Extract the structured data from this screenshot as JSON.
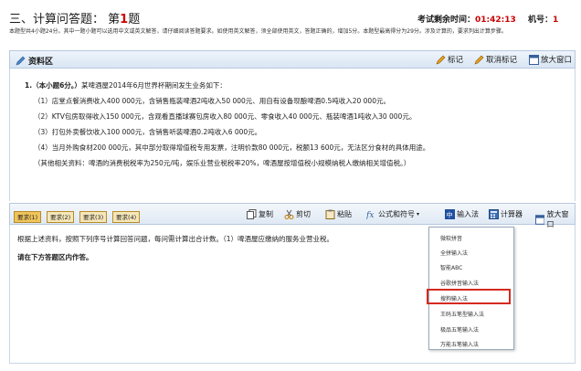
{
  "header": {
    "section": "三、计算问答题：",
    "question_prefix": "第",
    "question_number": "1",
    "question_suffix": "题",
    "timer_label": "考试剩余时间：",
    "timer_value": "01:42:13",
    "machine_label": "机号：",
    "machine_value": "1",
    "note": "本题型共4小题24分。其中一题小题可以选用中文或英文解答，请仔细阅读答题要求。如使用英文解答，须全部使用英文，答题正确的，增加5分。本题型最高得分为29分。涉及计算的，要求列出计算步骤。"
  },
  "material": {
    "title": "资料区",
    "mark": "标记",
    "unmark": "取消标记",
    "enlarge": "放大窗口",
    "question": "1.（本小题6分。）",
    "intro": "某啤酒屋2014年6月世界杯期间发生业务如下：",
    "items": [
      "（1）店堂点餐消费收入400 000元，含销售瓶装啤酒2吨收入50 000元、用自有设备现酿啤酒0.5吨收入20 000元。",
      "（2）KTV包房取得收入150 000元，含观看直播球赛包房收入80 000元、零食收入40 000元、瓶装啤酒1吨收入30 000元。",
      "（3）打包外卖餐饮收入100 000元，含销售听装啤酒0.2吨收入6 000元。",
      "（4）当月外购食材200 000元，其中部分取得增值税专用发票，注明价款80 000元，税额13 600元，无法区分食材的具体用途。",
      "（其他相关资料：啤酒的消费税税率为250元/吨，娱乐业营业税税率20%，啤酒屋按增值税小规模纳税人缴纳相关增值税。）"
    ]
  },
  "answer": {
    "tabs": [
      "要求(1)",
      "要求(2)",
      "要求(3)",
      "要求(4)"
    ],
    "copy": "复制",
    "cut": "剪切",
    "paste": "粘贴",
    "formula": "公式和符号",
    "ime": "输入法",
    "calculator": "计算器",
    "enlarge": "放大窗口",
    "requirement": "根据上述资料，按照下列序号计算回答问题，每问需计算出合计数。（1）啤酒屋应缴纳的服务业营业税。",
    "hint": "请在下方答题区内作答。"
  },
  "ime_menu": {
    "items": [
      "微软拼音",
      "全拼输入法",
      "智能ABC",
      "谷歌拼音输入法",
      "搜狗输入法",
      "王码五笔型输入法",
      "极品五笔输入法",
      "万能五笔输入法"
    ],
    "selected_index": 4
  },
  "colors": {
    "accent_red": "#cc0000",
    "highlight": "#d42a1f",
    "toolbar": "#dfe9f4"
  }
}
